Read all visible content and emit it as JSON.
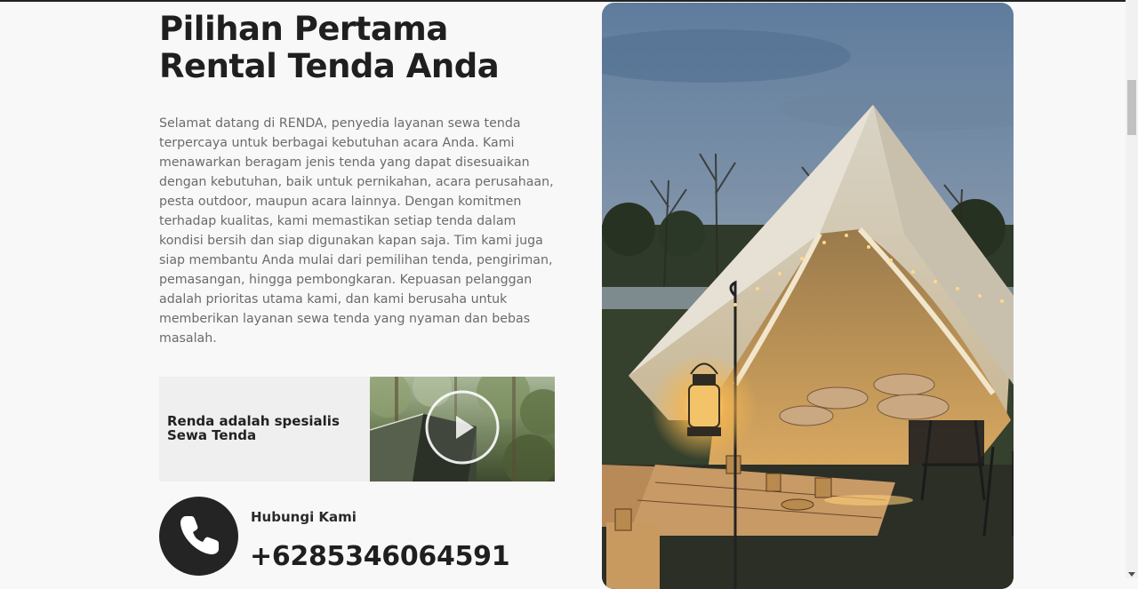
{
  "heading": {
    "line1": "Pilihan Pertama",
    "line2": "Rental Tenda Anda"
  },
  "intro_text": "Selamat datang di RENDA, penyedia layanan sewa tenda terpercaya untuk berbagai kebutuhan acara Anda. Kami menawarkan beragam jenis tenda yang dapat disesuaikan dengan kebutuhan, baik untuk pernikahan, acara perusahaan, pesta outdoor, maupun acara lainnya. Dengan komitmen terhadap kualitas, kami memastikan setiap tenda dalam kondisi bersih dan siap digunakan kapan saja. Tim kami juga siap membantu Anda mulai dari pemilihan tenda, pengiriman, pemasangan, hingga pembongkaran. Kepuasan pelanggan adalah prioritas utama kami, dan kami berusaha untuk memberikan layanan sewa tenda yang nyaman dan bebas masalah.",
  "promo": {
    "line1": "Renda adalah spesialis",
    "line2": "Sewa Tenda"
  },
  "contact": {
    "label": "Hubungi Kami",
    "phone": "+6285346064591"
  },
  "icons": {
    "video": "play-icon",
    "contact": "phone-icon"
  },
  "colors": {
    "background": "#f8f8f8",
    "heading": "#1f1f1f",
    "body_text": "#6b6b6b",
    "icon_circle": "#242424"
  }
}
